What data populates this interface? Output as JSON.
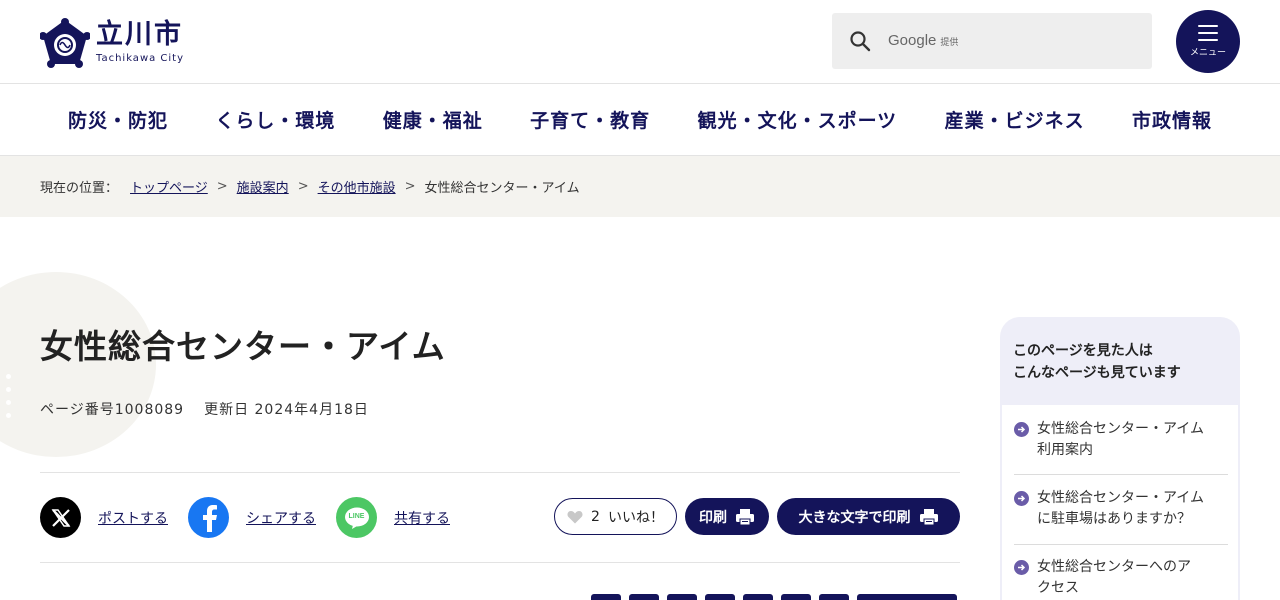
{
  "header": {
    "logo_title": "立川市",
    "logo_sub": "Tachikawa City",
    "search_brand": "Google",
    "search_brand_suffix": "提供",
    "menu_label": "メニュー"
  },
  "nav": [
    "防災・防犯",
    "くらし・環境",
    "健康・福祉",
    "子育て・教育",
    "観光・文化・スポーツ",
    "産業・ビジネス",
    "市政情報"
  ],
  "breadcrumb": {
    "lead": "現在の位置：",
    "links": [
      "トップページ",
      "施設案内",
      "その他市施設"
    ],
    "current": "女性総合センター・アイム"
  },
  "page": {
    "title": "女性総合センター・アイム",
    "page_number": "ページ番号1008089",
    "updated": "更新日 2024年4月18日"
  },
  "share": {
    "x_label": "ポストする",
    "facebook_label": "シェアする",
    "line_label": "共有する",
    "line_icon_text": "LINE"
  },
  "actions": {
    "like_count": "2",
    "like_label": "いいね！",
    "print_label": "印刷",
    "large_print_label": "大きな文字で印刷"
  },
  "sidebar": {
    "heading_line1": "このページを見た人は",
    "heading_line2": "こんなページも見ています",
    "items": [
      {
        "line1": "女性総合センター・アイム",
        "line2": "利用案内"
      },
      {
        "line1": "女性総合センター・アイム",
        "line2": "に駐車場はありますか？"
      },
      {
        "line1": "女性総合センターへのア",
        "line2": "クセス"
      }
    ]
  },
  "colors": {
    "brand": "#14145a",
    "breadcrumb_bg": "#f4f3ef",
    "sidebar_bg": "#eeeef8",
    "facebook": "#1877f2",
    "line": "#4cc764"
  }
}
